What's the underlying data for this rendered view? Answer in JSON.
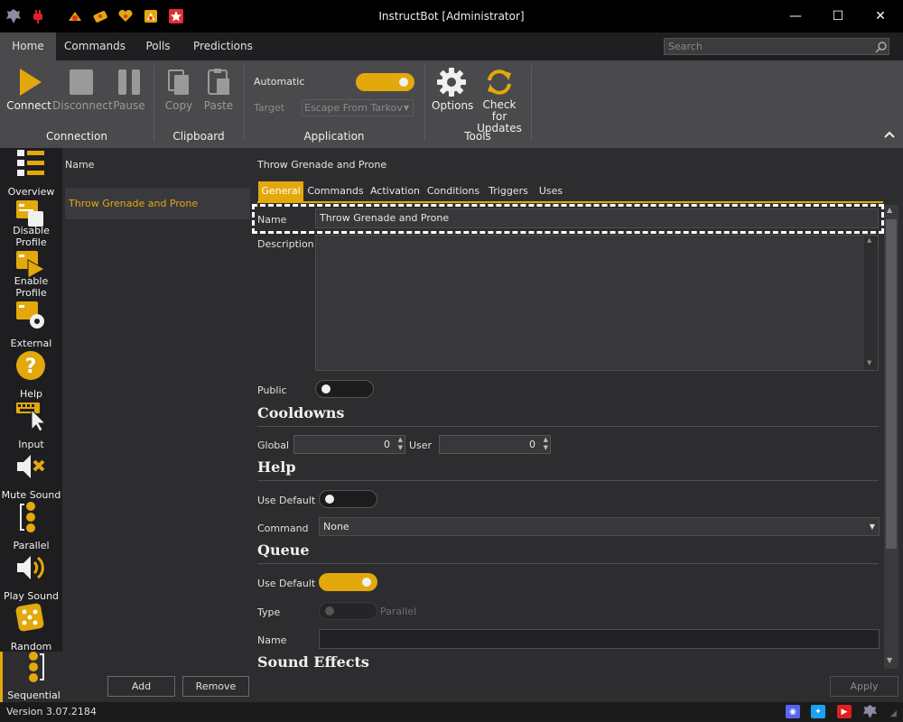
{
  "window": {
    "title": "InstructBot [Administrator]",
    "minimize": "—",
    "maximize": "☐",
    "close": "✕"
  },
  "menu": {
    "tabs": [
      "Home",
      "Commands",
      "Polls",
      "Predictions"
    ],
    "search_placeholder": "Search"
  },
  "ribbon": {
    "connect": "Connect",
    "disconnect": "Disconnect",
    "pause": "Pause",
    "copy": "Copy",
    "paste": "Paste",
    "automatic": "Automatic",
    "target": "Target",
    "target_value": "Escape From Tarkov",
    "options": "Options",
    "check_updates_1": "Check for",
    "check_updates_2": "Updates",
    "groups": {
      "connection": "Connection",
      "clipboard": "Clipboard",
      "application": "Application",
      "tools": "Tools"
    }
  },
  "sidebar": {
    "items": [
      "Overview",
      "Disable Profile",
      "Enable Profile",
      "External",
      "Help",
      "Input",
      "Mute Sound",
      "Parallel",
      "Play Sound",
      "Random",
      "Sequential"
    ]
  },
  "list": {
    "header": "Name",
    "items": [
      "Throw Grenade and Prone"
    ],
    "add": "Add",
    "remove": "Remove"
  },
  "detail": {
    "title": "Throw Grenade and Prone",
    "tabs": [
      "General",
      "Commands",
      "Activation",
      "Conditions",
      "Triggers",
      "Uses"
    ],
    "name_label": "Name",
    "name_value": "Throw Grenade and Prone",
    "description_label": "Description",
    "public_label": "Public",
    "cooldowns": "Cooldowns",
    "global_label": "Global",
    "global_value": "0",
    "user_label": "User",
    "user_value": "0",
    "help": "Help",
    "use_default_label": "Use Default",
    "command_label": "Command",
    "command_value": "None",
    "queue": "Queue",
    "type_label": "Type",
    "parallel_label": "Parallel",
    "queue_name_label": "Name",
    "sound_effects": "Sound Effects",
    "apply": "Apply"
  },
  "status": {
    "version": "Version 3.07.2184"
  },
  "colors": {
    "accent": "#e3a80b",
    "ribbon": "#4a4a4d",
    "background": "#2d2d30"
  }
}
